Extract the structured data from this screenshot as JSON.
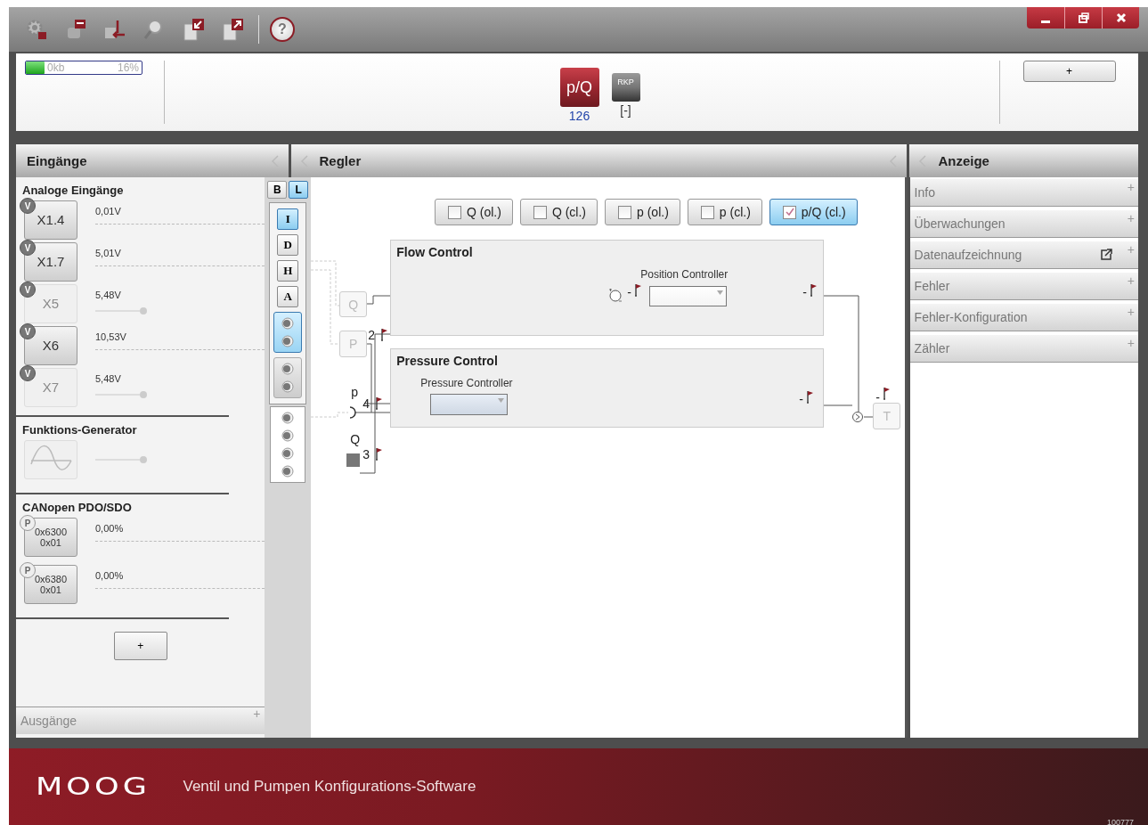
{
  "toolbar": {
    "tools": [
      {
        "kind": "settings"
      },
      {
        "kind": "connect"
      },
      {
        "kind": "import"
      },
      {
        "kind": "search"
      },
      {
        "kind": "load"
      },
      {
        "kind": "save"
      }
    ],
    "help": "?"
  },
  "memory": {
    "text": "0kb",
    "percent": "16%",
    "level": 0.16
  },
  "devices": [
    {
      "label": "p/Q",
      "value": "126",
      "selected": true
    },
    {
      "label": "RKP",
      "value": "[-]",
      "selected": false
    }
  ],
  "add_device": "+",
  "left_panel": {
    "title": "Eingänge",
    "sections": [
      {
        "title": "Analoge Eingänge",
        "kind": "analog",
        "inputs": [
          {
            "badge": "V",
            "label": [
              "X1.4"
            ],
            "value": "0,01V",
            "disabled": false
          },
          {
            "badge": "V",
            "label": [
              "X1.7"
            ],
            "value": "5,01V",
            "disabled": false
          },
          {
            "badge": "V",
            "label": [
              "X5"
            ],
            "value": "5,48V",
            "disabled": true
          },
          {
            "badge": "V",
            "label": [
              "X6"
            ],
            "value": "10,53V",
            "disabled": false
          },
          {
            "badge": "V",
            "label": [
              "X7"
            ],
            "value": "5,48V",
            "disabled": true
          }
        ]
      },
      {
        "title": "Funktions-Generator",
        "kind": "generator",
        "inputs": [
          {
            "disabled": true
          }
        ]
      },
      {
        "title": "CANopen PDO/SDO",
        "kind": "canopen",
        "inputs": [
          {
            "badge": "P",
            "label": [
              "0x6300",
              "0x01"
            ],
            "value": "0,00%",
            "disabled": false
          },
          {
            "badge": "P",
            "label": [
              "0x6380",
              "0x01"
            ],
            "value": "0,00%",
            "disabled": false
          }
        ]
      }
    ],
    "add_button": "+",
    "footer": {
      "label": "Ausgänge",
      "expander": "+"
    }
  },
  "strip": {
    "tabs": [
      {
        "label": "B",
        "selected": false
      },
      {
        "label": "L",
        "selected": true
      }
    ],
    "filters": [
      {
        "label": "I",
        "selected": true
      },
      {
        "label": "D",
        "selected": false
      },
      {
        "label": "H",
        "selected": false
      },
      {
        "label": "A",
        "selected": false
      }
    ],
    "connector_groups": [
      {
        "kind": "pair",
        "selected": true
      },
      {
        "kind": "pair",
        "selected": false
      },
      {
        "kind": "quad",
        "selected": false
      }
    ]
  },
  "center_panel": {
    "title": "Regler",
    "modes": [
      {
        "label": "Q (ol.)",
        "checked": false,
        "selected": false
      },
      {
        "label": "Q (cl.)",
        "checked": false,
        "selected": false
      },
      {
        "label": "p (ol.)",
        "checked": false,
        "selected": false
      },
      {
        "label": "p (cl.)",
        "checked": false,
        "selected": false
      },
      {
        "label": "p/Q (cl.)",
        "checked": true,
        "selected": true
      }
    ],
    "diagram": {
      "blocks": [
        {
          "title": "Flow Control",
          "controller": "Position Controller",
          "signs": [
            "-",
            "-"
          ]
        },
        {
          "title": "Pressure Control",
          "controller": "Pressure Controller",
          "signs": [
            "-"
          ]
        }
      ],
      "sources": [
        {
          "label": "Q"
        },
        {
          "label": "P"
        }
      ],
      "output": {
        "label": "T",
        "sign": "-"
      },
      "markers": [
        {
          "number": "2"
        },
        {
          "name": "p",
          "number": "4"
        },
        {
          "name": "Q",
          "number": "3"
        }
      ]
    }
  },
  "display_panel": {
    "title": "Anzeige",
    "items": [
      {
        "label": "Info",
        "expander": "+",
        "popout": false
      },
      {
        "label": "Überwachungen",
        "expander": "+",
        "popout": false
      },
      {
        "label": "Datenaufzeichnung",
        "expander": "+",
        "popout": true
      },
      {
        "label": "Fehler",
        "expander": "+",
        "popout": false
      },
      {
        "label": "Fehler-Konfiguration",
        "expander": "+",
        "popout": false
      },
      {
        "label": "Zähler",
        "expander": "+",
        "popout": false
      }
    ]
  },
  "footer": {
    "logo": "MOOG",
    "subtitle": "Ventil und Pumpen Konfigurations-Software",
    "build": "100777"
  }
}
